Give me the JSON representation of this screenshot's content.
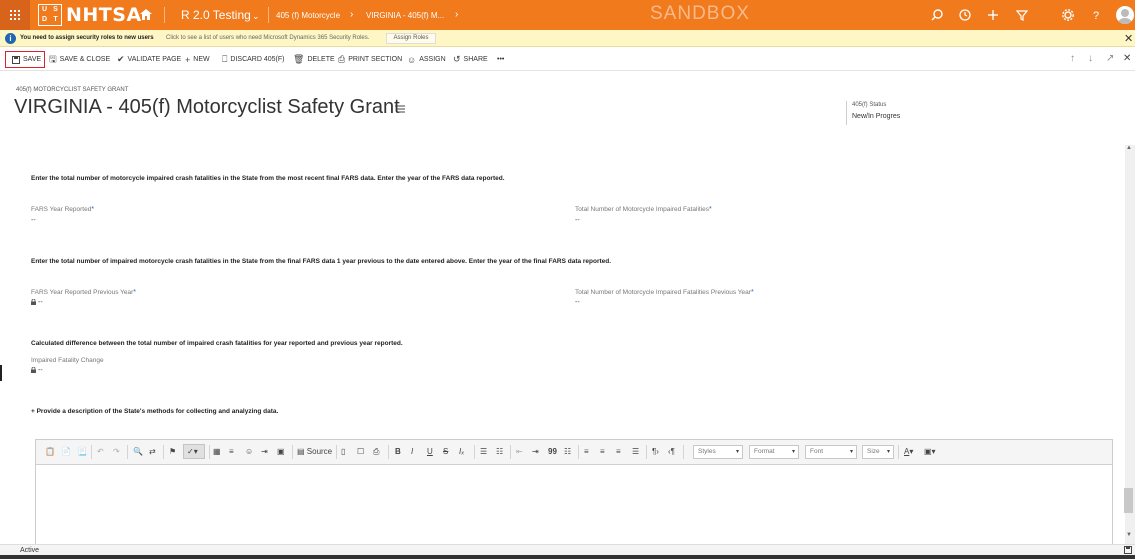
{
  "topbar": {
    "logo_text": "NHTSA",
    "logo_mark": [
      "U",
      "S",
      "D",
      "T"
    ],
    "environment": "R 2.0 Testing",
    "breadcrumb_1": "405 (f) Motorcycle",
    "breadcrumb_2": "VIRGINIA - 405(f) M...",
    "sandbox": "SANDBOX",
    "accent_color": "#f07a1c",
    "icons": [
      "search-icon",
      "history-icon",
      "plus-icon",
      "filter-icon",
      "gear-icon",
      "help-icon",
      "user-avatar"
    ]
  },
  "notice": {
    "bold": "You need to assign security roles to new users",
    "text": "Click to see a list of users who need Microsoft Dynamics 365 Security Roles.",
    "button": "Assign Roles"
  },
  "commands": {
    "save": "SAVE",
    "save_close": "SAVE & CLOSE",
    "validate": "VALIDATE PAGE",
    "new": "NEW",
    "discard": "DISCARD 405(F)",
    "delete": "DELETE",
    "print": "PRINT SECTION",
    "assign": "ASSIGN",
    "share": "SHARE",
    "more": "•••"
  },
  "header": {
    "entity": "405(f) MOTORCYCLIST SAFETY GRANT",
    "title": "VIRGINIA - 405(f) Motorcyclist Safety Grant",
    "status_label": "405(f) Status",
    "status_value": "New/In Progres"
  },
  "form": {
    "q1": "Enter the total number of motorcycle impaired crash fatalities in the State from the most recent final FARS data. Enter the year of the FARS data reported.",
    "fars_year_label": "FARS Year Reported",
    "fars_year_value": "--",
    "total_label": "Total Number of Motorcycle Impaired Fatalities",
    "total_value": "--",
    "q2": "Enter the total number of impaired motorcycle crash fatalities in the State from the final FARS data 1 year previous to the date entered above. Enter the year of the final FARS data reported.",
    "prev_year_label": "FARS Year Reported Previous Year",
    "prev_year_value": "--",
    "prev_total_label": "Total Number of Motorcycle Impaired Fatalities Previous Year",
    "prev_total_value": "--",
    "q3": "Calculated difference between the total number of impaired crash fatalities for year reported and previous year reported.",
    "change_label": "Impaired Fatality Change",
    "change_value": "--",
    "q4": "+ Provide a description of the State's methods for collecting and analyzing data.",
    "required_mark": "*"
  },
  "editor": {
    "source": "Source",
    "styles": "Styles",
    "format": "Format",
    "font": "Font",
    "size": "Size",
    "bold": "B",
    "italic": "I",
    "underline": "U",
    "strike": "S",
    "quote": "99",
    "font_color": "A"
  },
  "statusbar": {
    "state": "Active"
  }
}
